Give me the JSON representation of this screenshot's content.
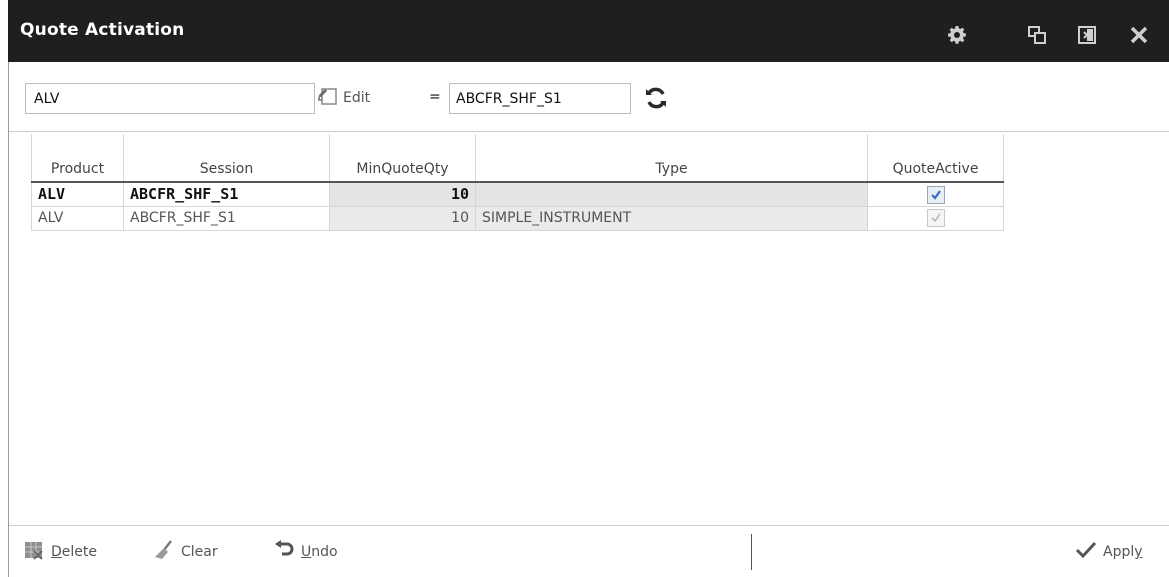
{
  "window": {
    "title": "Quote Activation"
  },
  "toolbar": {
    "product_value": "ALV",
    "edit_label": "Edit",
    "equals": "=",
    "session_value": "ABCFR_SHF_S1"
  },
  "table": {
    "columns": [
      "Product",
      "Session",
      "MinQuoteQty",
      "Type",
      "QuoteActive"
    ],
    "rows": [
      {
        "product": "ALV",
        "session": "ABCFR_SHF_S1",
        "min_qty": "10",
        "type": "",
        "quote_active": true
      },
      {
        "product": "ALV",
        "session": "ABCFR_SHF_S1",
        "min_qty": "10",
        "type": "SIMPLE_INSTRUMENT",
        "quote_active": true
      }
    ]
  },
  "footer": {
    "delete_first": "D",
    "delete_rest": "elete",
    "clear_label": "Clear",
    "undo_first": "U",
    "undo_rest": "ndo",
    "apply_main": "Appl",
    "apply_last": "y"
  },
  "icons": {
    "settings": "gear-icon",
    "restore": "restore-window-icon",
    "dock": "dock-icon",
    "close": "close-icon",
    "edit": "edit-icon",
    "refresh": "refresh-icon",
    "delete": "delete-grid-icon",
    "clear": "broom-icon",
    "undo": "undo-icon",
    "apply": "checkmark-icon"
  },
  "colors": {
    "titlebar_bg": "#1f1f1f",
    "check_blue": "#3a6fc4"
  }
}
